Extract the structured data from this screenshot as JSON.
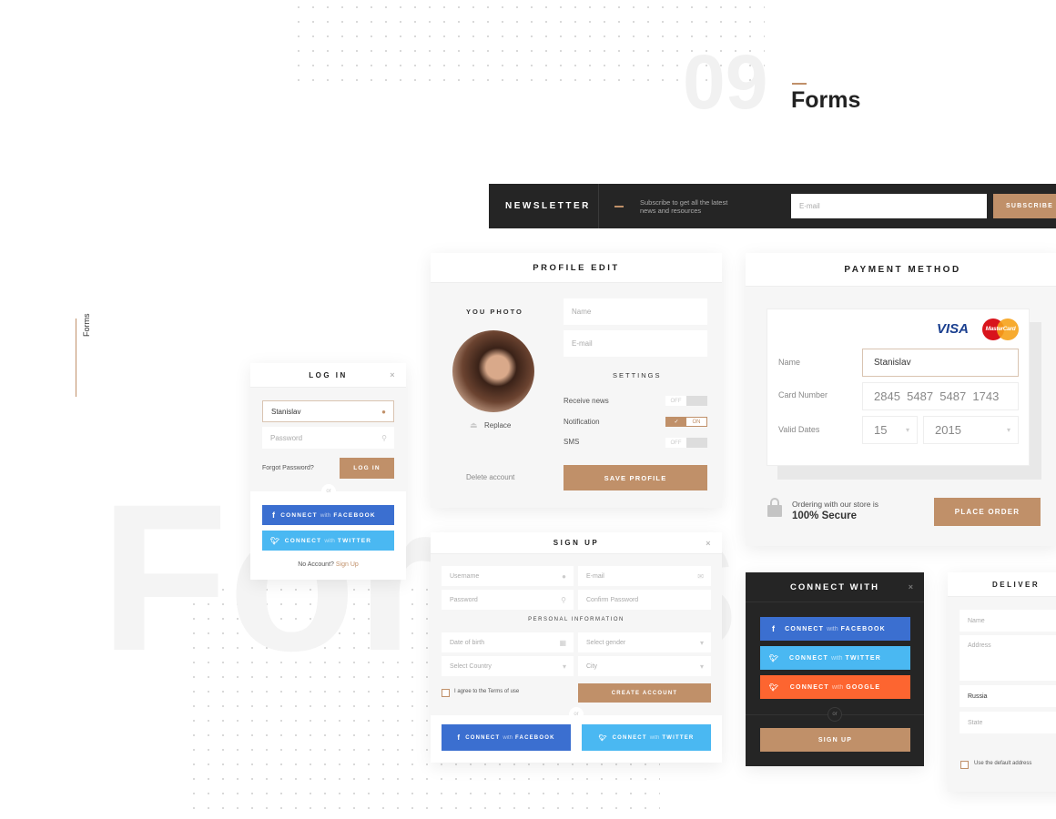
{
  "section": {
    "number": "09",
    "title": "Forms",
    "side_label": "Forms",
    "watermark": "Forms"
  },
  "colors": {
    "accent": "#c09069",
    "facebook": "#3b6fd0",
    "twitter": "#4ab8f2",
    "google": "#fd6530",
    "dark": "#252525"
  },
  "newsletter": {
    "title": "NEWSLETTER",
    "text1": "Subscribe to get all the latest",
    "text2": "news and resources",
    "email_placeholder": "E-mail",
    "button": "SUBSCRIBE"
  },
  "profile": {
    "title": "PROFILE EDIT",
    "photo_label": "YOU PHOTO",
    "replace": "Replace",
    "name_placeholder": "Name",
    "email_placeholder": "E-mail",
    "settings": "SETTINGS",
    "toggles": [
      {
        "label": "Receive news",
        "state": "OFF"
      },
      {
        "label": "Notification",
        "state": "ON"
      },
      {
        "label": "SMS",
        "state": "OFF"
      }
    ],
    "delete": "Delete account",
    "save": "SAVE PROFILE"
  },
  "payment": {
    "title": "PAYMENT METHOD",
    "visa": "VISA",
    "mastercard": "MasterCard",
    "name_label": "Name",
    "name_value": "Stanislav",
    "card_label": "Card Number",
    "card_value": "2845  5487  5487  1743",
    "dates_label": "Valid Dates",
    "day": "15",
    "year": "2015",
    "secure1": "Ordering with our store is",
    "secure2": "100% Secure",
    "button": "PLACE ORDER"
  },
  "login": {
    "title": "LOG IN",
    "close": "×",
    "username": "Stanislav",
    "password_placeholder": "Password",
    "forgot": "Forgot Password?",
    "button": "LOG IN",
    "or": "or",
    "connect": "CONNECT",
    "with": "with",
    "facebook": "FACEBOOK",
    "twitter": "TWITTER",
    "no_account": "No Account?",
    "signup": "Sign Up"
  },
  "signup": {
    "title": "SIGN UP",
    "close": "×",
    "username": "Username",
    "email": "E-mail",
    "password": "Password",
    "confirm": "Confirm Password",
    "personal": "PERSONAL INFORMATION",
    "dob": "Date of birth",
    "gender": "Select gender",
    "country": "Select Country",
    "city": "City",
    "terms": "I agree to the Terms of use",
    "create": "CREATE ACCOUNT",
    "or": "or",
    "connect": "CONNECT",
    "with": "with",
    "facebook": "FACEBOOK",
    "twitter": "TWITTER"
  },
  "connect": {
    "title": "CONNECT WITH",
    "close": "×",
    "connect": "CONNECT",
    "with": "with",
    "facebook": "FACEBOOK",
    "twitter": "TWITTER",
    "google": "GOOGLE",
    "or": "or",
    "signup": "SIGN UP"
  },
  "delivery": {
    "title": "DELIVER",
    "name": "Name",
    "address": "Address",
    "country": "Russia",
    "state": "State",
    "default": "Use the default address"
  }
}
